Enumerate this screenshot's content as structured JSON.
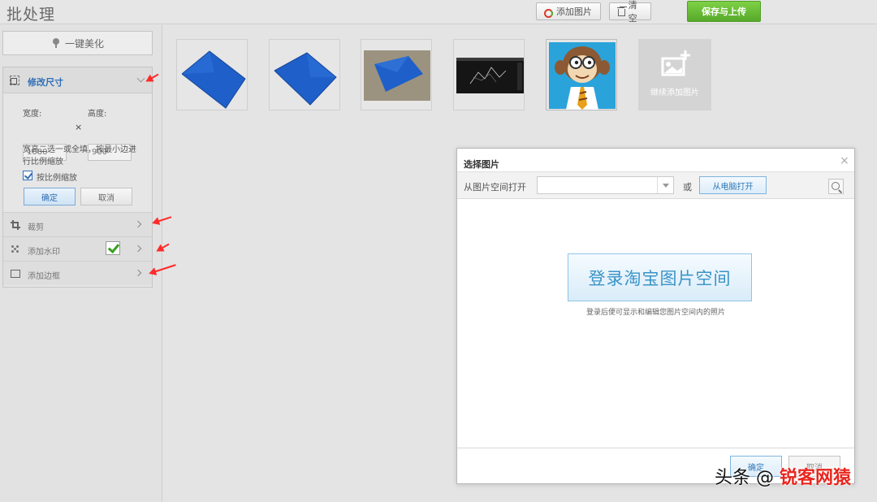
{
  "app": {
    "title": "批处理"
  },
  "toolbar": {
    "add_images_label": "添加图片",
    "clear_label": "清空",
    "save_upload_label": "保存与上传",
    "add_icon": "add-image-icon",
    "clear_icon": "trash-icon"
  },
  "sidebar": {
    "beautify_label": "一键美化",
    "resize": {
      "title": "修改尺寸",
      "width_label": "宽度:",
      "height_label": "高度:",
      "width_value": "1080",
      "height_value": "900",
      "times_sign": "×",
      "hint": "宽高二选一或全填，按最小边进行比例缩放",
      "keep_ratio_label": "按比例缩放",
      "keep_ratio_checked": true,
      "ok_label": "确定",
      "cancel_label": "取消"
    },
    "tools": [
      {
        "label": "裁剪",
        "icon": "crop-icon"
      },
      {
        "label": "添加水印",
        "icon": "watermark-icon",
        "enabled_check": true
      },
      {
        "label": "添加边框",
        "icon": "border-icon"
      }
    ]
  },
  "thumbnails": {
    "items": [
      {
        "kind": "blue-tarp-1"
      },
      {
        "kind": "blue-tarp-2"
      },
      {
        "kind": "tarp-on-sand"
      },
      {
        "kind": "dark-screenshot"
      },
      {
        "kind": "monkey-avatar"
      }
    ],
    "add_more_label": "继续添加图片"
  },
  "dialog": {
    "title": "选择图片",
    "close_glyph": "×",
    "open_from_space_label": "从图片空间打开",
    "or_label": "或",
    "open_from_pc_label": "从电脑打开",
    "login_button_label": "登录淘宝图片空间",
    "login_hint": "登录后便可显示和编辑您图片空间内的照片",
    "ok_label": "确定",
    "cancel_label": "取消"
  },
  "watermark": {
    "text_black": "头条 @",
    "text_red": "锐客网猿"
  },
  "colors": {
    "accent_blue": "#2f6fb7",
    "save_green": "#56a92a",
    "annotation_red": "#ff2a2a",
    "tarp_blue": "#1f5fc9"
  }
}
